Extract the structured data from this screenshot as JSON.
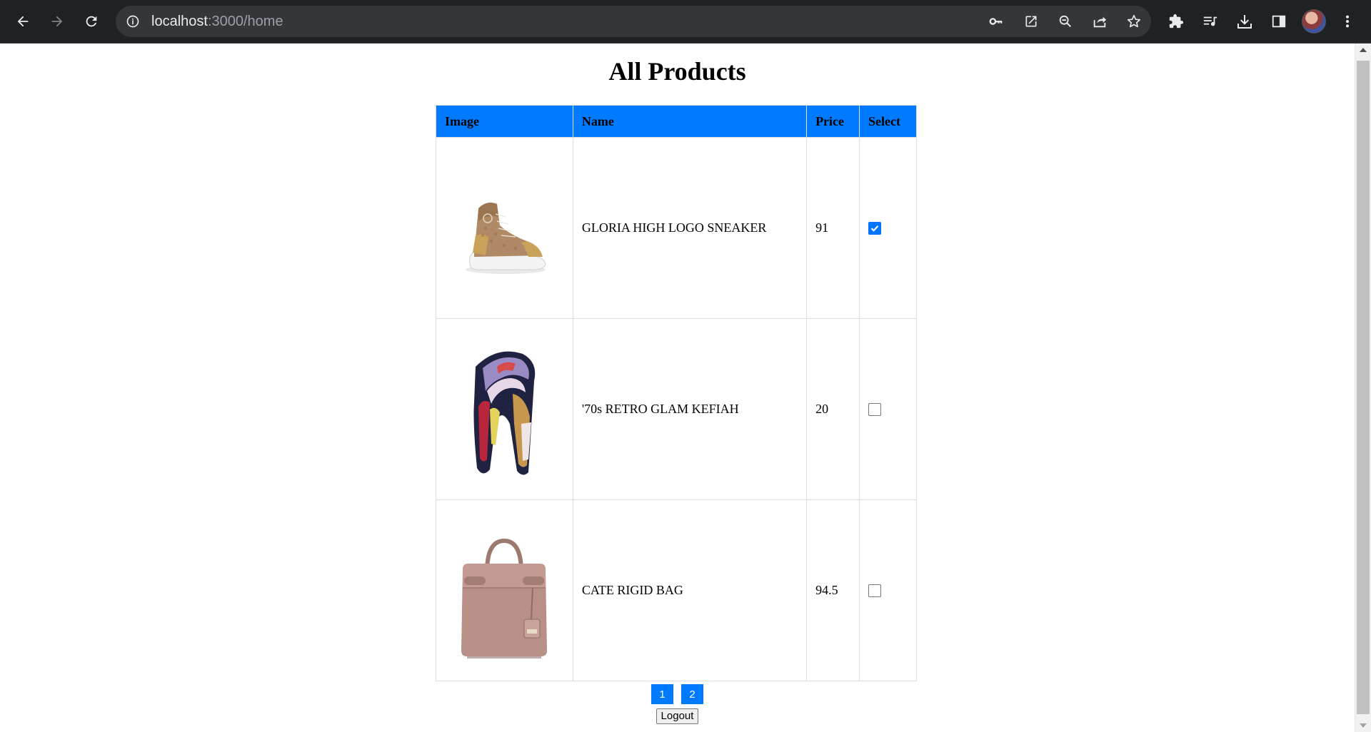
{
  "browser": {
    "url_host": "localhost",
    "url_path": ":3000/home",
    "icons": {
      "back": "back-arrow-icon",
      "forward": "forward-arrow-icon",
      "reload": "reload-icon",
      "info": "info-icon",
      "key": "key-icon",
      "open_external": "open-external-icon",
      "zoom_out": "zoom-out-icon",
      "share": "share-icon",
      "bookmark": "star-icon",
      "extensions": "puzzle-icon",
      "media": "media-queue-icon",
      "downloads": "download-icon",
      "side_panel": "side-panel-icon",
      "menu": "kebab-menu-icon"
    }
  },
  "page": {
    "title": "All Products",
    "table": {
      "headers": [
        "Image",
        "Name",
        "Price",
        "Select"
      ],
      "rows": [
        {
          "image": "gold-sneaker-image",
          "name": "GLORIA HIGH LOGO SNEAKER",
          "price": "91",
          "selected": true
        },
        {
          "image": "scarf-image",
          "name": "'70s RETRO GLAM KEFIAH",
          "price": "20",
          "selected": false
        },
        {
          "image": "handbag-image",
          "name": "CATE RIGID BAG",
          "price": "94.5",
          "selected": false
        }
      ]
    },
    "pagination": [
      "1",
      "2"
    ],
    "logout_label": "Logout"
  },
  "colors": {
    "header_bg": "#007bff",
    "pagination_bg": "#007bff",
    "checkbox_checked": "#0075ff",
    "chrome_bg": "#202124"
  }
}
